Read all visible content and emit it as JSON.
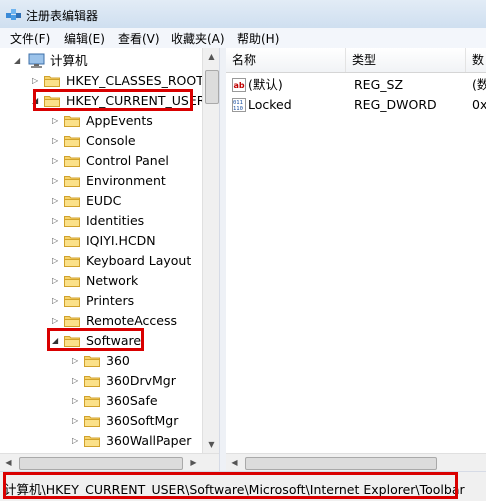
{
  "window": {
    "title": "注册表编辑器",
    "accent": "#d90000"
  },
  "menu": [
    "文件(F)",
    "编辑(E)",
    "查看(V)",
    "收藏夹(A)",
    "帮助(H)"
  ],
  "tree": {
    "root": "计算机",
    "items": [
      {
        "label": "HKEY_CLASSES_ROOT",
        "level": 1,
        "expanded": false
      },
      {
        "label": "HKEY_CURRENT_USER",
        "level": 1,
        "expanded": true,
        "highlighted": true
      },
      {
        "label": "AppEvents",
        "level": 2,
        "expanded": false
      },
      {
        "label": "Console",
        "level": 2,
        "expanded": false
      },
      {
        "label": "Control Panel",
        "level": 2,
        "expanded": false
      },
      {
        "label": "Environment",
        "level": 2,
        "expanded": false
      },
      {
        "label": "EUDC",
        "level": 2,
        "expanded": false
      },
      {
        "label": "Identities",
        "level": 2,
        "expanded": false
      },
      {
        "label": "IQIYI.HCDN",
        "level": 2,
        "expanded": false
      },
      {
        "label": "Keyboard Layout",
        "level": 2,
        "expanded": false
      },
      {
        "label": "Network",
        "level": 2,
        "expanded": false
      },
      {
        "label": "Printers",
        "level": 2,
        "expanded": false
      },
      {
        "label": "RemoteAccess",
        "level": 2,
        "expanded": false
      },
      {
        "label": "Software",
        "level": 2,
        "expanded": true,
        "highlighted": true
      },
      {
        "label": "360",
        "level": 3,
        "expanded": false
      },
      {
        "label": "360DrvMgr",
        "level": 3,
        "expanded": false
      },
      {
        "label": "360Safe",
        "level": 3,
        "expanded": false
      },
      {
        "label": "360SoftMgr",
        "level": 3,
        "expanded": false
      },
      {
        "label": "360WallPaper",
        "level": 3,
        "expanded": false
      }
    ]
  },
  "list": {
    "columns": [
      "名称",
      "类型",
      "数"
    ],
    "rows": [
      {
        "name": "(默认)",
        "type": "REG_SZ",
        "data": "(数",
        "icon": "string-value-icon"
      },
      {
        "name": "Locked",
        "type": "REG_DWORD",
        "data": "0x",
        "icon": "binary-value-icon"
      }
    ]
  },
  "status": {
    "path": "计算机\\HKEY_CURRENT_USER\\Software\\Microsoft\\Internet Explorer\\Toolbar"
  }
}
